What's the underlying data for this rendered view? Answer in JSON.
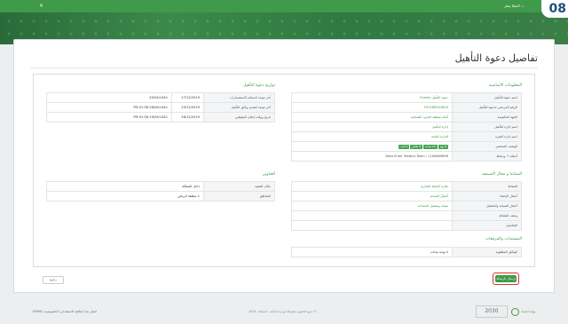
{
  "header": {
    "badge": "08",
    "user_name": "د. العطا بشار",
    "close_symbol": "×"
  },
  "page": {
    "title": "تفاصيل دعوة التأهيل"
  },
  "basic_info": {
    "title": "المعلومات الأساسية",
    "rows": [
      {
        "label": "اسم دعوة التأهيل",
        "value": "دعوة التأهيل Evoms"
      },
      {
        "label": "الرقم المرجعي لدعوة التأهيل",
        "value": "191260001604"
      },
      {
        "label": "الجهة الحكومية",
        "value": "أمانة منطقة الحدود الشمالية"
      },
      {
        "label": "اسم إدارة التأهيل",
        "value": "إدارة التأهيل"
      },
      {
        "label": "اسم إدارة الفترة",
        "value": "الإدارة العامة"
      },
      {
        "label": "الوصف المختصر",
        "value": "",
        "tags": [
          "6 يوم",
          "21 ساعة",
          "8 دقائق",
          "0 ثانية"
        ]
      },
      {
        "label": "أسئلة + وسائط",
        "value": "Data Enter Testbut Team / 1164689896"
      }
    ]
  },
  "dates": {
    "title": "تواريخ دعوة التأهيل",
    "rows": [
      {
        "label": "آخر موعد لاستلام الاستفسارات",
        "date1": "17/12/2019",
        "date2": "20/04/1441"
      },
      {
        "label": "آخر موعد لتقديم وثائق التأهيل",
        "date1": "25/12/2019",
        "date2": "28/04/1441 PM 01:58"
      },
      {
        "label": "تاريخ ووقت إعلان المؤهلين",
        "date1": "26/12/2019",
        "date2": "29/04/1441 PM 01:58"
      }
    ]
  },
  "activity": {
    "title": "النشاط و مجال التصنيف",
    "rows": [
      {
        "label": "النشاط",
        "value": "تجارة الجملة التجارية"
      },
      {
        "label": "أعمال الإنشاء",
        "value": "أعمال الصيانة"
      },
      {
        "label": "أعمال الصيانة والتشغيل",
        "value": "صيانة وتشغيل المساجد"
      },
      {
        "label": "وصف النشاط",
        "value": ""
      },
      {
        "label": "التفاصيل",
        "value": ""
      }
    ]
  },
  "address": {
    "title": "العناوين",
    "rows": [
      {
        "label": "مكان التنفيذ",
        "value": "داخل المملكة"
      },
      {
        "label": "المناطق",
        "value": "1 منطقة الرياض"
      }
    ]
  },
  "documents": {
    "title": "المستندات والمرفقات",
    "rows": [
      {
        "label": "الوثائق المطلوبة",
        "value": "لا توجد بيانات"
      }
    ]
  },
  "actions": {
    "back_label": "رجوع",
    "submit_label": "إرسال الرسالة"
  },
  "footer": {
    "links": "اتصل بنا | اتفاقية الاستخدام | الخصوصية | 19990",
    "copyright": "© جميع الحقوق محفوظة لوزارة المالية - المملكة - 2019",
    "vision": "2030",
    "logo_text": "بوابة اعتماد"
  },
  "colors": {
    "brand": "#3f9a49",
    "highlight": "#d33333"
  }
}
